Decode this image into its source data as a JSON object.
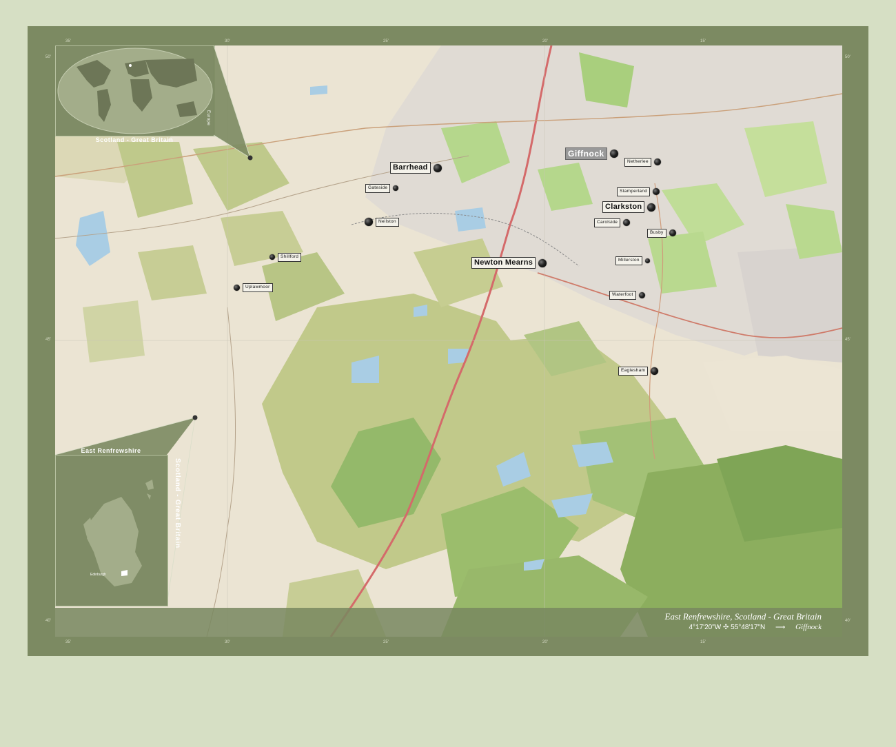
{
  "region": {
    "name": "East Renfrewshire",
    "country_caption": "Scotland - Great Britain"
  },
  "world_inset": {
    "caption": "Scotland - Great Britain",
    "continent": "Europe"
  },
  "country_inset": {
    "caption": "East Renfrewshire",
    "vertical_caption": "Scotland - Great Britain",
    "city": "Edinburgh"
  },
  "footer": {
    "title": "East Renfrewshire, Scotland - Great Britain",
    "coords": "4°17'20\"W ✣ 55°48'17\"N",
    "arrow": "⟶",
    "capital": "Giffnock"
  },
  "ticks": {
    "top": [
      "35'",
      "30'",
      "25'",
      "20'",
      "15'"
    ],
    "bottom": [
      "35'",
      "30'",
      "25'",
      "20'",
      "15'"
    ],
    "left": [
      "50'",
      "45'",
      "40'"
    ],
    "right": [
      "50'",
      "45'",
      "40'"
    ]
  },
  "places": [
    {
      "label": "Giffnock",
      "style": "huge"
    },
    {
      "label": "Netherlee",
      "style": "small"
    },
    {
      "label": "Barrhead",
      "style": "big"
    },
    {
      "label": "Gateside",
      "style": "small"
    },
    {
      "label": "Stamperland",
      "style": "small"
    },
    {
      "label": "Clarkston",
      "style": "big"
    },
    {
      "label": "Carolside",
      "style": "small"
    },
    {
      "label": "Busby",
      "style": "small"
    },
    {
      "label": "Neilston",
      "style": "small"
    },
    {
      "label": "Newton Mearns",
      "style": "big"
    },
    {
      "label": "Shillford",
      "style": "small"
    },
    {
      "label": "Millerston",
      "style": "small"
    },
    {
      "label": "Uplawmoor",
      "style": "small"
    },
    {
      "label": "Waterfoot",
      "style": "small"
    },
    {
      "label": "Eaglesham",
      "style": "small"
    }
  ],
  "colors": {
    "frame": "#7c8a62",
    "background": "#d6dfc4",
    "urban": "#e0dbd4",
    "farmland": "#ece5d4",
    "moor": "#c1c98a",
    "woodland": "#9bbd6c",
    "forest": "#8cae5e",
    "water": "#a9cde4",
    "motorway": "#d46a6a"
  }
}
